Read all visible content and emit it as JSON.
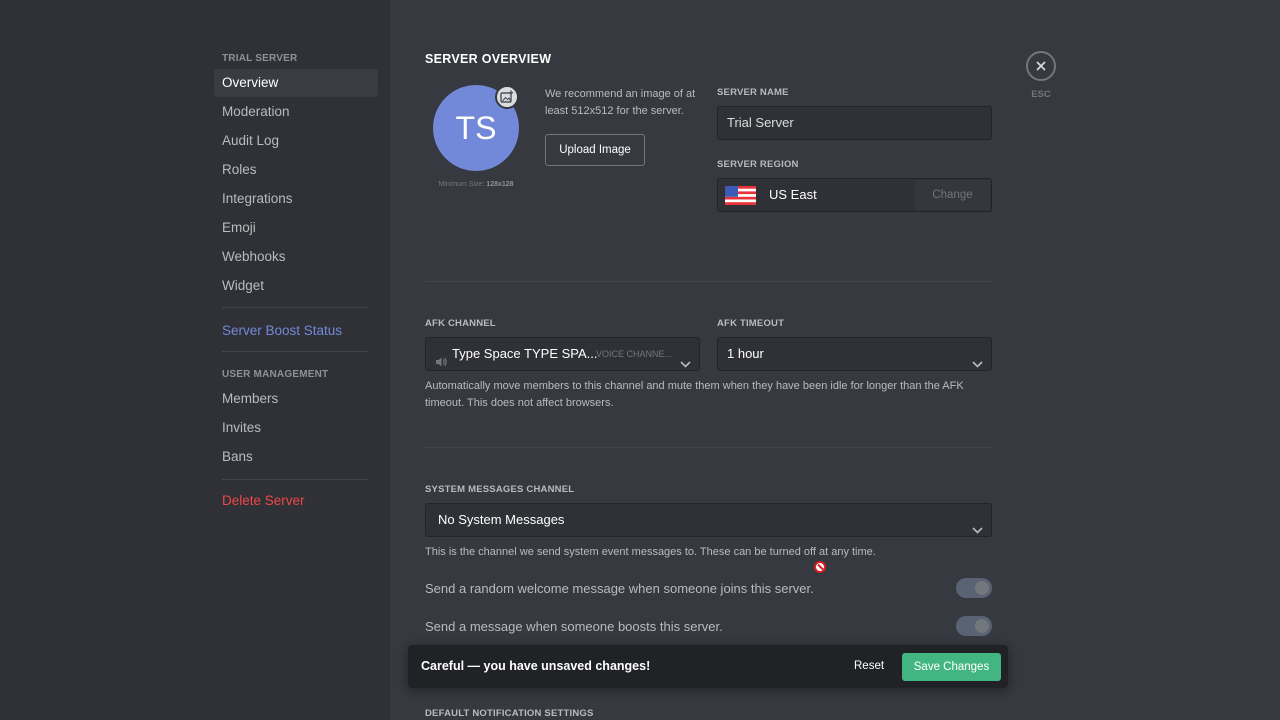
{
  "sidebar": {
    "server_heading": "TRIAL SERVER",
    "items": [
      {
        "label": "Overview"
      },
      {
        "label": "Moderation"
      },
      {
        "label": "Audit Log"
      },
      {
        "label": "Roles"
      },
      {
        "label": "Integrations"
      },
      {
        "label": "Emoji"
      },
      {
        "label": "Webhooks"
      },
      {
        "label": "Widget"
      }
    ],
    "boost_label": "Server Boost Status",
    "user_mgmt_heading": "USER MANAGEMENT",
    "user_items": [
      {
        "label": "Members"
      },
      {
        "label": "Invites"
      },
      {
        "label": "Bans"
      }
    ],
    "delete_label": "Delete Server"
  },
  "overview": {
    "title": "SERVER OVERVIEW",
    "avatar_initials": "TS",
    "min_size_label": "Minimum Size:",
    "min_size_value": "128x128",
    "recommend_text": "We recommend an image of at least 512x512 for the server.",
    "upload_label": "Upload Image",
    "server_name_label": "SERVER NAME",
    "server_name_value": "Trial Server",
    "server_region_label": "SERVER REGION",
    "server_region_value": "US East",
    "change_label": "Change"
  },
  "afk": {
    "channel_label": "AFK CHANNEL",
    "channel_value": "Type Space TYPE SPA...",
    "channel_category": "VOICE CHANNE...",
    "timeout_label": "AFK TIMEOUT",
    "timeout_value": "1 hour",
    "help": "Automatically move members to this channel and mute them when they have been idle for longer than the AFK timeout. This does not affect browsers."
  },
  "system": {
    "channel_label": "SYSTEM MESSAGES CHANNEL",
    "channel_value": "No System Messages",
    "help": "This is the channel we send system event messages to. These can be turned off at any time.",
    "toggle_welcome": "Send a random welcome message when someone joins this server.",
    "toggle_boost": "Send a message when someone boosts this server."
  },
  "notification_heading": "DEFAULT NOTIFICATION SETTINGS",
  "notice": {
    "text": "Careful — you have unsaved changes!",
    "reset_label": "Reset",
    "save_label": "Save Changes"
  },
  "close": {
    "esc_label": "ESC"
  },
  "colors": {
    "background": "#36393f",
    "sidebar": "#2f3136",
    "blurple": "#7289da",
    "danger": "#f04747",
    "success": "#43b581"
  }
}
